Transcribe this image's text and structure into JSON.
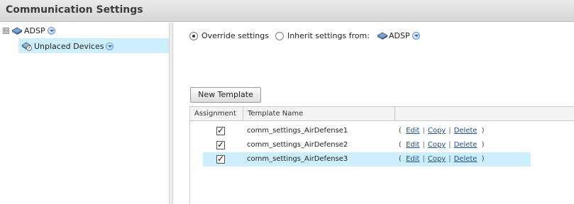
{
  "window": {
    "title": "Communication Settings"
  },
  "tree": {
    "root": {
      "expander": "⊟",
      "label": "ADSP",
      "icon": "network-device-icon"
    },
    "child": {
      "label": "Unplaced Devices",
      "icon": "unplaced-devices-icon",
      "selected": true
    }
  },
  "settings": {
    "override_label": "Override settings",
    "inherit_label": "Inherit settings from:",
    "inherit_source": "ADSP",
    "selected": "override"
  },
  "toolbar": {
    "new_template_label": "New Template"
  },
  "table": {
    "columns": [
      "Assignment",
      "Template Name",
      ""
    ],
    "rows": [
      {
        "assigned": true,
        "name": "comm_settings_AirDefense1",
        "highlighted": false
      },
      {
        "assigned": true,
        "name": "comm_settings_AirDefense2",
        "highlighted": false
      },
      {
        "assigned": true,
        "name": "comm_settings_AirDefense3",
        "highlighted": true
      }
    ],
    "actions": {
      "open": "(",
      "edit": "Edit",
      "sep": "|",
      "copy": "Copy",
      "delete": "Delete",
      "close": ")"
    }
  },
  "colors": {
    "selection": "#cdeffd",
    "link": "#1f4f8f",
    "titlebar": "#dcdcdc"
  }
}
